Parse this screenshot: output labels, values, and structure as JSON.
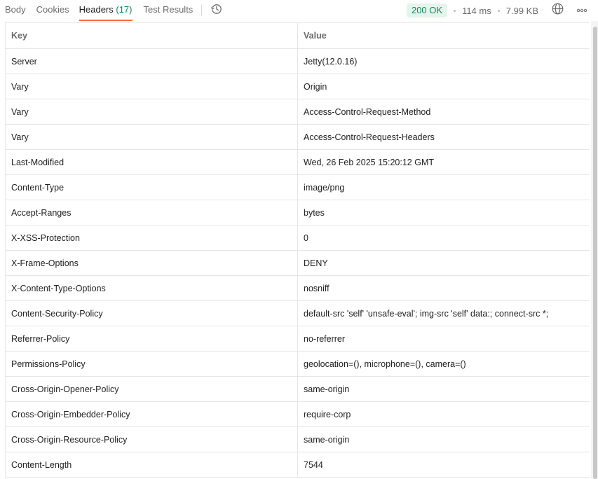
{
  "tabs": {
    "body": "Body",
    "cookies": "Cookies",
    "headers": "Headers",
    "headers_count": "(17)",
    "test_results": "Test Results"
  },
  "status": {
    "code": "200 OK",
    "time": "114 ms",
    "size": "7.99 KB"
  },
  "table": {
    "columns": [
      "Key",
      "Value"
    ],
    "rows": [
      {
        "key": "Server",
        "value": "Jetty(12.0.16)"
      },
      {
        "key": "Vary",
        "value": "Origin"
      },
      {
        "key": "Vary",
        "value": "Access-Control-Request-Method"
      },
      {
        "key": "Vary",
        "value": "Access-Control-Request-Headers"
      },
      {
        "key": "Last-Modified",
        "value": "Wed, 26 Feb 2025 15:20:12 GMT"
      },
      {
        "key": "Content-Type",
        "value": "image/png"
      },
      {
        "key": "Accept-Ranges",
        "value": "bytes"
      },
      {
        "key": "X-XSS-Protection",
        "value": "0"
      },
      {
        "key": "X-Frame-Options",
        "value": "DENY"
      },
      {
        "key": "X-Content-Type-Options",
        "value": "nosniff"
      },
      {
        "key": "Content-Security-Policy",
        "value": "default-src 'self' 'unsafe-eval'; img-src 'self' data:; connect-src *;"
      },
      {
        "key": "Referrer-Policy",
        "value": "no-referrer"
      },
      {
        "key": "Permissions-Policy",
        "value": "geolocation=(), microphone=(), camera=()"
      },
      {
        "key": "Cross-Origin-Opener-Policy",
        "value": "same-origin"
      },
      {
        "key": "Cross-Origin-Embedder-Policy",
        "value": "require-corp"
      },
      {
        "key": "Cross-Origin-Resource-Policy",
        "value": "same-origin"
      },
      {
        "key": "Content-Length",
        "value": "7544"
      }
    ]
  },
  "icons": {
    "history": "history-icon",
    "globe": "globe-icon",
    "more": "more-horizontal-icon"
  },
  "colors": {
    "accent": "#f26b3a",
    "status_ok_text": "#0f8a5f",
    "status_ok_bg": "#e6f5ec"
  }
}
